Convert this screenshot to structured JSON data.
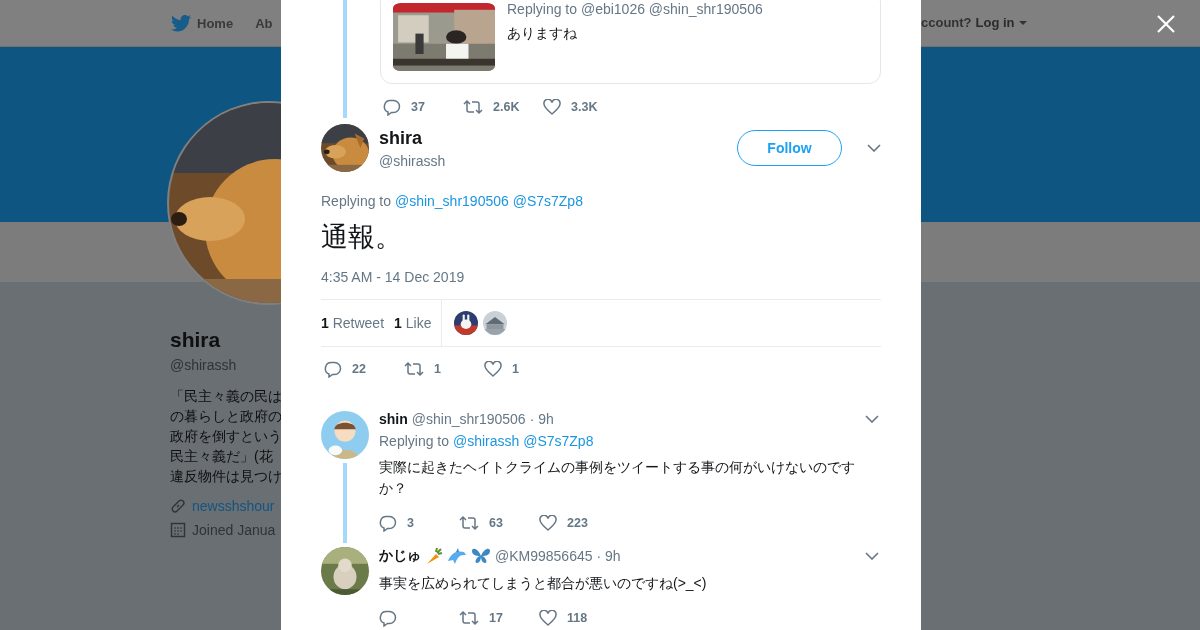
{
  "nav": {
    "items": [
      {
        "label": "Home"
      },
      {
        "label": "Ab"
      }
    ],
    "login_prompt": "ccount?",
    "login": "Log in"
  },
  "profile": {
    "name": "shira",
    "handle": "@shirassh",
    "bio_lines": [
      "「民主々義の民は",
      "の暮らしと政府の",
      "政府を倒すという",
      "民主々義だ」(花",
      "違反物件は見つけ"
    ],
    "link": "newsshshour",
    "joined": "Joined Janua"
  },
  "quoted_tweet": {
    "replying": "Replying to @ebi1026 @shin_shr190506",
    "text": "ありますね",
    "replies": "37",
    "retweets": "2.6K",
    "likes": "3.3K"
  },
  "tweet": {
    "name": "shira",
    "handle": "@shirassh",
    "follow": "Follow",
    "replying_prefix": "Replying to",
    "mentions": [
      "@shin_shr190506",
      "@S7s7Zp8"
    ],
    "text": "通報。",
    "time": "4:35 AM - 14 Dec 2019",
    "retweet_count": "1",
    "retweet_label": "Retweet",
    "like_count": "1",
    "like_label": "Like",
    "replies": "22",
    "retweets": "1",
    "likes": "1"
  },
  "replies": [
    {
      "name": "shin",
      "handle": "@shin_shr190506",
      "age": "· 9h",
      "replying_prefix": "Replying to",
      "mentions": [
        "@shirassh",
        "@S7s7Zp8"
      ],
      "text": "実際に起きたヘイトクライムの事例をツイートする事の何がいけないのですか？",
      "replies": "3",
      "retweets": "63",
      "likes": "223",
      "thread_line": true
    },
    {
      "name": "かじゅ",
      "badges": [
        {
          "kind": "carrot"
        },
        {
          "kind": "dolphin"
        },
        {
          "kind": "butterfly"
        }
      ],
      "handle": "@KM99856645",
      "age": "· 9h",
      "text": "事実を広められてしまうと都合が悪いのですね(>_<)",
      "retweets": "17",
      "likes": "118",
      "thread_line": false
    }
  ]
}
